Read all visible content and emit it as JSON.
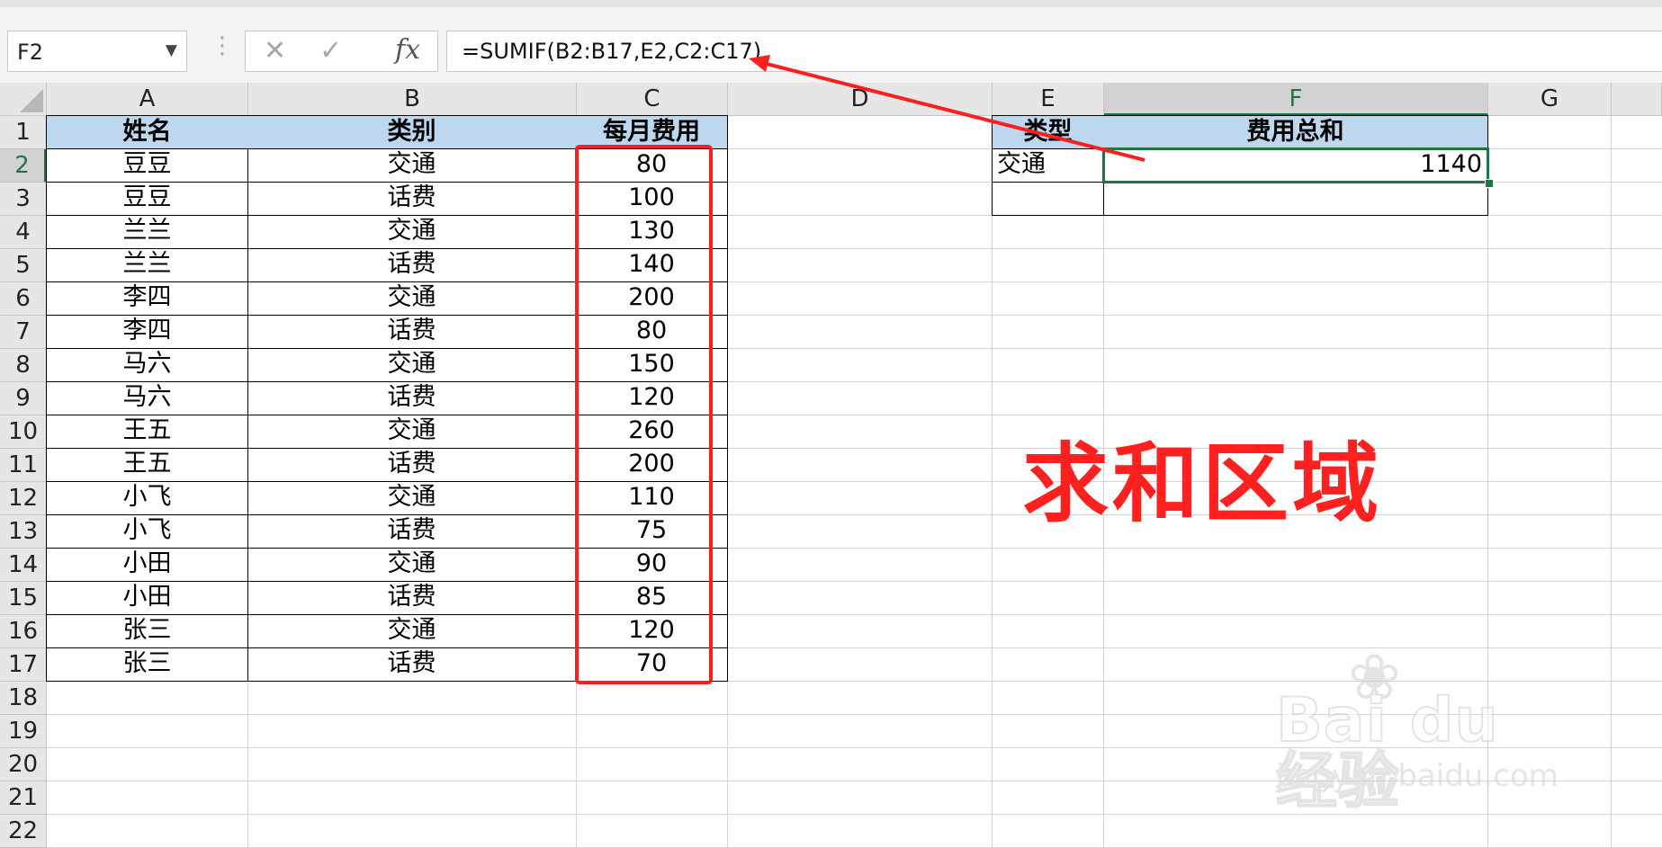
{
  "name_box": {
    "value": "F2"
  },
  "formula_bar": {
    "cancel_glyph": "✕",
    "enter_glyph": "✓",
    "fx_label": "fx",
    "formula": "=SUMIF(B2:B17,E2,C2:C17)"
  },
  "columns": [
    "A",
    "B",
    "C",
    "D",
    "E",
    "F",
    "G"
  ],
  "selected_cell": "F2",
  "rows": [
    "1",
    "2",
    "3",
    "4",
    "5",
    "6",
    "7",
    "8",
    "9",
    "10",
    "11",
    "12",
    "13",
    "14",
    "15",
    "16",
    "17",
    "18",
    "19",
    "20",
    "21",
    "22"
  ],
  "table": {
    "headers": [
      "姓名",
      "类别",
      "每月费用"
    ],
    "data": [
      [
        "豆豆",
        "交通",
        "80"
      ],
      [
        "豆豆",
        "话费",
        "100"
      ],
      [
        "兰兰",
        "交通",
        "130"
      ],
      [
        "兰兰",
        "话费",
        "140"
      ],
      [
        "李四",
        "交通",
        "200"
      ],
      [
        "李四",
        "话费",
        "80"
      ],
      [
        "马六",
        "交通",
        "150"
      ],
      [
        "马六",
        "话费",
        "120"
      ],
      [
        "王五",
        "交通",
        "260"
      ],
      [
        "王五",
        "话费",
        "200"
      ],
      [
        "小飞",
        "交通",
        "110"
      ],
      [
        "小飞",
        "话费",
        "75"
      ],
      [
        "小田",
        "交通",
        "90"
      ],
      [
        "小田",
        "话费",
        "85"
      ],
      [
        "张三",
        "交通",
        "120"
      ],
      [
        "张三",
        "话费",
        "70"
      ]
    ]
  },
  "summary": {
    "header_e": "类型",
    "header_f": "费用总和",
    "e2": "交通",
    "f2": "1140"
  },
  "annotation": {
    "text": "求和区域",
    "color": "#ff2020"
  },
  "watermark": {
    "brand": "Bai du 经验",
    "url": "jingyan.baidu.com"
  },
  "colors": {
    "header_fill": "#bdd7ee",
    "selection": "#217346",
    "annot_red": "#ff1e1e"
  }
}
